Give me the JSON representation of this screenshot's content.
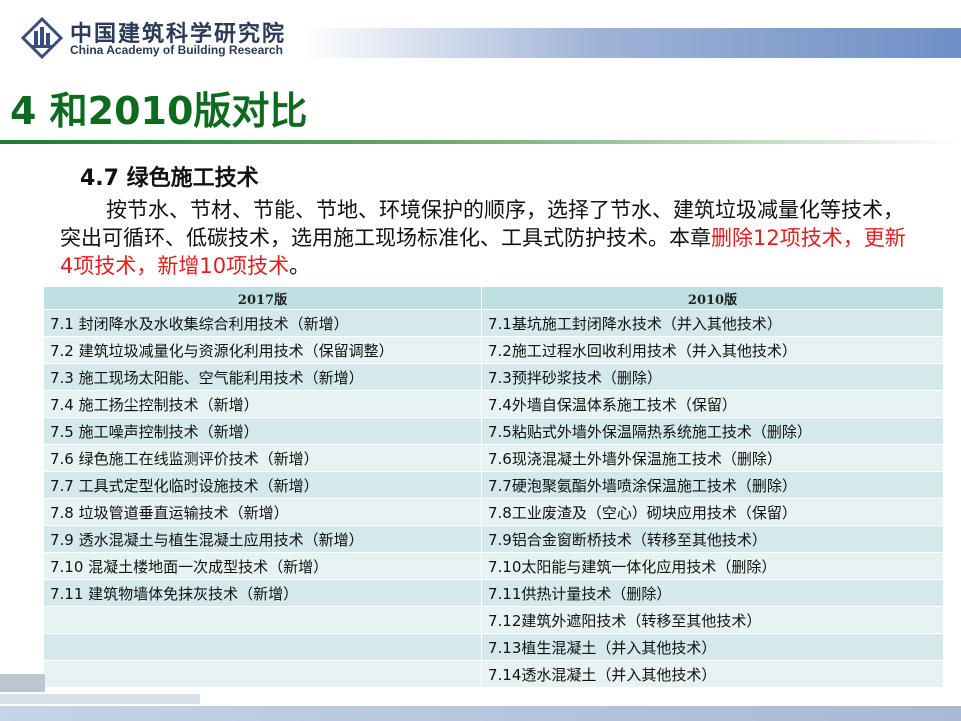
{
  "header": {
    "org_name_cn": "中国建筑科学研究院",
    "org_name_en": "China Academy of Building Research"
  },
  "slide": {
    "title": "4 和2010版对比",
    "section_title": "4.7 绿色施工技术",
    "intro_part1": "按节水、节材、节能、节地、环境保护的顺序，选择了节水、建筑垃圾减量化等技术，突出可循环、低碳技术，选用施工现场标准化、工具式防护技术。本章",
    "intro_red": "删除12项技术，更新4项技术，新增10项技术",
    "intro_end": "。"
  },
  "table": {
    "headers": [
      "2017版",
      "2010版"
    ],
    "rows": [
      [
        "7.1 封闭降水及水收集综合利用技术（新增）",
        "7.1基坑施工封闭降水技术（并入其他技术）"
      ],
      [
        "7.2 建筑垃圾减量化与资源化利用技术（保留调整）",
        "7.2施工过程水回收利用技术（并入其他技术）"
      ],
      [
        "7.3 施工现场太阳能、空气能利用技术（新增）",
        "7.3预拌砂浆技术（删除）"
      ],
      [
        "7.4 施工扬尘控制技术（新增）",
        "7.4外墙自保温体系施工技术（保留）"
      ],
      [
        "7.5 施工噪声控制技术（新增）",
        "7.5粘贴式外墙外保温隔热系统施工技术（删除）"
      ],
      [
        "7.6 绿色施工在线监测评价技术（新增）",
        "7.6现浇混凝土外墙外保温施工技术（删除）"
      ],
      [
        "7.7 工具式定型化临时设施技术（新增）",
        "7.7硬泡聚氨酯外墙喷涂保温施工技术（删除）"
      ],
      [
        "7.8 垃圾管道垂直运输技术（新增）",
        "7.8工业废渣及（空心）砌块应用技术（保留）"
      ],
      [
        "7.9 透水混凝土与植生混凝土应用技术（新增）",
        "7.9铝合金窗断桥技术（转移至其他技术）"
      ],
      [
        "7.10 混凝土楼地面一次成型技术（新增）",
        "7.10太阳能与建筑一体化应用技术（删除）"
      ],
      [
        "7.11 建筑物墙体免抹灰技术（新增）",
        "7.11供热计量技术（删除）"
      ],
      [
        "",
        "7.12建筑外遮阳技术（转移至其他技术）"
      ],
      [
        "",
        "7.13植生混凝土（并入其他技术）"
      ],
      [
        "",
        "7.14透水混凝土（并入其他技术）"
      ]
    ]
  },
  "colors": {
    "title_green": "#0d6a1f",
    "highlight_red": "#e02020",
    "table_header_bg": "#bfe0e3",
    "table_row_bg": "#d5e9ec"
  }
}
